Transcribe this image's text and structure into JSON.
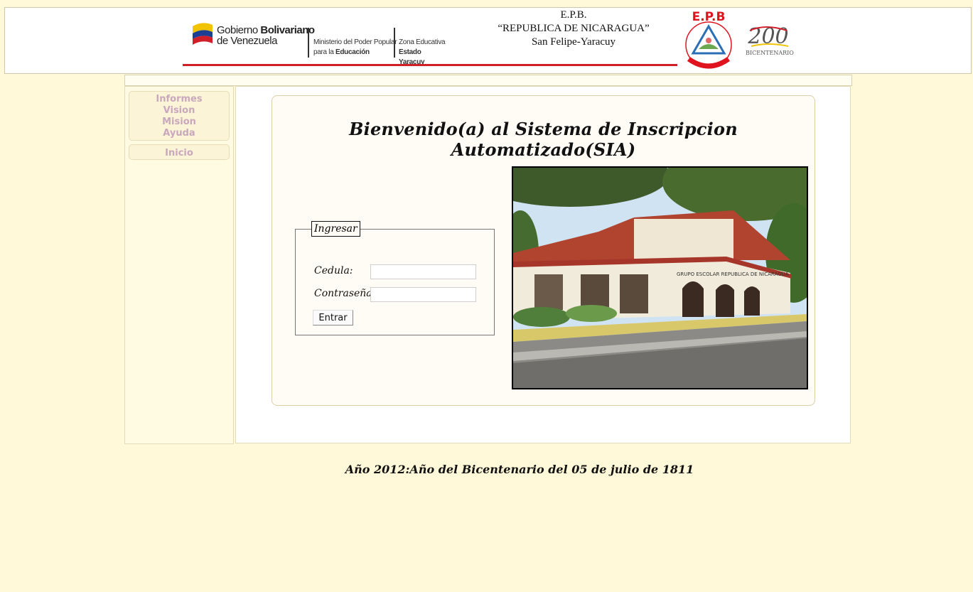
{
  "header": {
    "gov_line1_prefix": "Gobierno ",
    "gov_line1_bold": "Bolivariano",
    "gov_line2": "de Venezuela",
    "ministry_line1": "Ministerio  del Poder Popular",
    "ministry_line2_prefix": "para la ",
    "ministry_line2_bold": "Educación",
    "zona_line1": "Zona Educativa",
    "zona_line2": "Estado Yaracuy",
    "school_line1": "E.P.B.",
    "school_line2": "“REPUBLICA DE  NICARAGUA”",
    "school_line3": "San Felipe-Yaracuy",
    "epb_logo_text": "E.P.B",
    "epb_logo_ring": "REPUBLICA DE NICARAGUA",
    "bicent_number": "200",
    "bicent_text": "BICENTENARIO"
  },
  "sidebar": {
    "menu_items": [
      "Informes",
      "Vision",
      "Mision",
      "Ayuda"
    ],
    "home_label": "Inicio"
  },
  "main": {
    "welcome_title": "Bienvenido(a) al Sistema de Inscripcion Automatizado(SIA)",
    "login": {
      "legend": "Ingresar",
      "cedula_label": "Cedula:",
      "cedula_value": "",
      "password_label": "Contraseña:",
      "password_value": "",
      "submit_label": "Entrar"
    },
    "photo_sign": "GRUPO  ESCOLAR  REPUBLICA  DE  NICARAGUA"
  },
  "footer": {
    "text": "Año 2012:Año del Bicentenario del 05 de julio de 1811"
  },
  "colors": {
    "page_bg": "#fff9d9",
    "menu_text": "#c9a8bd",
    "accent_red": "#d11f2a"
  }
}
